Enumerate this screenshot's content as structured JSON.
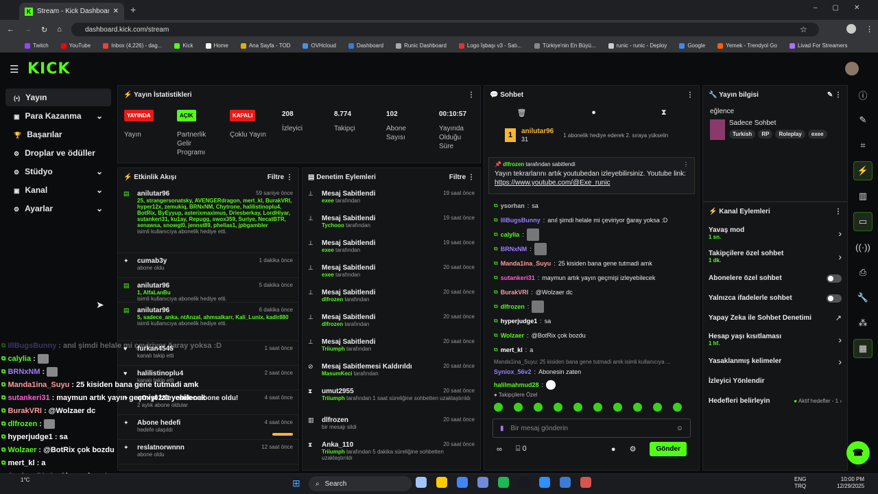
{
  "browser": {
    "tab_title": "Stream - Kick Dashboard",
    "url": "dashboard.kick.com/stream",
    "bookmarks": [
      "Twitch",
      "YouTube",
      "Inbox (4,226) - dag...",
      "Kick",
      "Home",
      "Ana Sayfa - TOD",
      "OVHcloud",
      "Dashboard",
      "Runic Dashboard",
      "Logo İşbaşı v3 - Satı...",
      "Türkiye'nin En Büyü...",
      "runic - runic - Deploy",
      "Google",
      "Yemek - Trendyol Go",
      "Livad For Streamers"
    ]
  },
  "sidebar": {
    "items": [
      {
        "label": "Yayın"
      },
      {
        "label": "Para Kazanma"
      },
      {
        "label": "Başarılar"
      },
      {
        "label": "Droplar ve ödüller"
      },
      {
        "label": "Stüdyo"
      },
      {
        "label": "Kanal"
      },
      {
        "label": "Ayarlar"
      }
    ]
  },
  "stats": {
    "title": "Yayın İstatistikleri",
    "s1_badge": "YAYINDA",
    "s1_label": "Yayın",
    "s2_badge": "AÇIK",
    "s2_label": "Partnerlik Gelir Programı",
    "s3_badge": "KAPALI",
    "s3_label": "Çoklu Yayın",
    "s4_val": "208",
    "s4_label": "İzleyici",
    "s5_val": "8.774",
    "s5_label": "Takipçi",
    "s6_val": "102",
    "s6_label": "Abone Sayısı",
    "s7_val": "00:10:57",
    "s7_label": "Yayında Olduğu Süre"
  },
  "activity": {
    "title": "Etkinlik Akışı",
    "filter": "Filtre",
    "items": [
      {
        "name": "anilutar96",
        "time": "59 saniye önce",
        "green": "25, strangersonatsky, AVENGERdragon, mert_kl, BurakVRI, hyper12x, zemukiq, BRNxNM, Chytrone, halilistinoplu4, BotRix, ByEyyup, asterixmaximus, Driesberkay, LordHiyar, sutankeri31, ku1ay, Repugg, swox359, Suriye, NecatBTR, senawsa, snowgl0, jennst89, phelias1, jpbgambler",
        "sub": "isimli kullanıcıya abonelik hediye etti."
      },
      {
        "name": "cumab3y",
        "time": "1 dakika önce",
        "green": "",
        "sub": "abone oldu"
      },
      {
        "name": "anilutar96",
        "time": "5 dakika önce",
        "green": "1, AlfaLanBu",
        "sub": "isimli kullanıcıya abonelik hediye etti."
      },
      {
        "name": "anilutar96",
        "time": "6 dakika önce",
        "green": "5, sadece_anka, ntAnzal, ahmsalkarr, Kali_Lunix, kadir880",
        "sub": "isimli kullanıcıya abonelik hediye etti."
      },
      {
        "name": "furkan4545",
        "time": "1 saat önce",
        "green": "",
        "sub": "kanalı takip etti"
      },
      {
        "name": "halilistinoplu4",
        "time": "2 saat önce",
        "green": "",
        "sub": "kanalı takip etti"
      },
      {
        "name": "nOxy0231 yeniden abone oldu!",
        "time": "4 saat önce",
        "green": "",
        "sub": "2 aylık abone oldular"
      },
      {
        "name": "Abone hedefi",
        "time": "4 saat önce",
        "green": "",
        "sub": "hedefe ulaşıldı"
      },
      {
        "name": "reslatnorwnnn",
        "time": "12 saat önce",
        "green": "",
        "sub": "abone oldu"
      }
    ]
  },
  "moderation": {
    "title": "Denetim Eylemleri",
    "filter": "Filtre",
    "items": [
      {
        "title": "Mesaj Sabitlendi",
        "time": "19 saat önce",
        "user": "exee",
        "suffix": "tarafından"
      },
      {
        "title": "Mesaj Sabitlendi",
        "time": "19 saat önce",
        "user": "Tychooo",
        "suffix": "tarafından"
      },
      {
        "title": "Mesaj Sabitlendi",
        "time": "19 saat önce",
        "user": "exee",
        "suffix": "tarafından"
      },
      {
        "title": "Mesaj Sabitlendi",
        "time": "20 saat önce",
        "user": "exee",
        "suffix": "tarafından"
      },
      {
        "title": "Mesaj Sabitlendi",
        "time": "20 saat önce",
        "user": "dlfrozen",
        "suffix": "tarafından"
      },
      {
        "title": "Mesaj Sabitlendi",
        "time": "20 saat önce",
        "user": "dlfrozen",
        "suffix": "tarafından"
      },
      {
        "title": "Mesaj Sabitlendi",
        "time": "20 saat önce",
        "user": "Triiumph",
        "suffix": "tarafından"
      },
      {
        "title": "Mesaj Sabitlemesi Kaldırıldı",
        "time": "20 saat önce",
        "user": "MasumKeci",
        "suffix": "tarafından"
      },
      {
        "title": "umut2955",
        "time": "20 saat önce",
        "user": "Triiumph",
        "suffix": "tarafından 1 saat süreliğine sohbetten uzaklaştırıldı"
      },
      {
        "title": "dlfrozen",
        "time": "20 saat önce",
        "user": "",
        "suffix": "bir mesajı sildi"
      },
      {
        "title": "Anka_110",
        "time": "20 saat önce",
        "user": "Triiumph",
        "suffix": "tarafından 5 dakika süreliğine sohbetten uzaklaştırıldı"
      }
    ]
  },
  "chat": {
    "title": "Sohbet",
    "top_user": "anilutar96",
    "top_count": "31",
    "top_note": "1 abonelik hediye ederek 2. sıraya yükselin",
    "pinned_by": "dlfrozen",
    "pinned_suffix": "tarafından sabitlendi",
    "pinned_text": "Yayın tekrarlarını artık youtubedan izleyebilirsiniz. Youtube link:",
    "pinned_link": "https://www.youtube.com/@Exe_runic",
    "lines": [
      {
        "user": "ysorhan",
        "color": "#bbbbbb",
        "text": "sa"
      },
      {
        "user": "IllBugsBunny",
        "color": "#9b7cff",
        "text": "anıl şimdi helale mi çeviriyor ğaray yoksa :D"
      },
      {
        "user": "calylia",
        "color": "#53fc18",
        "text": ""
      },
      {
        "user": "BRNxNM",
        "color": "#9b7cff",
        "text": ""
      },
      {
        "user": "Manda1ina_Suyu",
        "color": "#ff9a9a",
        "text": "25 kisiden bana gene tutmadi amk"
      },
      {
        "user": "sutankeri31",
        "color": "#ff5ecf",
        "text": "maymun artık yayın geçmişi izleyebilecek"
      },
      {
        "user": "BurakVRI",
        "color": "#ff9a9a",
        "text": "@Wolzaer dc"
      },
      {
        "user": "dlfrozen",
        "color": "#53fc18",
        "text": ""
      },
      {
        "user": "hyperjudge1",
        "color": "#ffffff",
        "text": "sa"
      },
      {
        "user": "Wolzaer",
        "color": "#53fc18",
        "text": "@BotRix çok bozdu"
      },
      {
        "user": "mert_kl",
        "color": "#ffffff",
        "text": "a"
      }
    ],
    "reply_text": "Manda1ina_Suyu: 25 kisiden bana gene tutmadi amk isimli kullanıcıya ...",
    "reply_user": "Syniox_56v2",
    "reply_msg": "Abonesin zaten",
    "last_user": "halilmahmud28",
    "followers_only": "Takipçilere Özel",
    "placeholder": "Bir mesaj gönderin",
    "points": "0",
    "send": "Gönder"
  },
  "info": {
    "title": "Yayın bilgisi",
    "category": "eğlence",
    "stream_title": "Sadece Sohbet",
    "tags": [
      "Turkish",
      "RP",
      "Roleplay",
      "exee"
    ]
  },
  "actions": {
    "title": "Kanal Eylemleri",
    "items": [
      {
        "label": "Yavaş mod",
        "sub": "1 sn.",
        "type": "arrow"
      },
      {
        "label": "Takipçilere özel sohbet",
        "sub": "1 dk.",
        "type": "arrow"
      },
      {
        "label": "Abonelere özel sohbet",
        "sub": "",
        "type": "toggle"
      },
      {
        "label": "Yalnızca ifadelerle sohbet",
        "sub": "",
        "type": "toggle"
      },
      {
        "label": "Yapay Zeka ile Sohbet Denetimi",
        "sub": "",
        "type": "ext"
      },
      {
        "label": "Hesap yaşı kısıtlaması",
        "sub": "1 hf.",
        "type": "arrow"
      },
      {
        "label": "Yasaklanmış kelimeler",
        "sub": "",
        "type": "arrow"
      },
      {
        "label": "İzleyici Yönlendir",
        "sub": "",
        "type": "none"
      },
      {
        "label": "Hedefleri belirleyin",
        "sub": "",
        "type": "goal",
        "extra": "Aktif hedefler - 1"
      }
    ]
  },
  "overlay": {
    "lines": [
      {
        "user": "IllBugsBunny",
        "color": "#9b7cff",
        "text": "anıl şimdi helale mi çeviriyor ğaray yoksa :D"
      },
      {
        "user": "calylia",
        "color": "#53fc18",
        "text": ""
      },
      {
        "user": "BRNxNM",
        "color": "#9b7cff",
        "text": ""
      },
      {
        "user": "Manda1ina_Suyu",
        "color": "#ff9a9a",
        "text": "25 kisiden bana gene tutmadi amk"
      },
      {
        "user": "sutankeri31",
        "color": "#ff5ecf",
        "text": "maymun artık yayın geçmişi izleyebilecek"
      },
      {
        "user": "BurakVRI",
        "color": "#ff9a9a",
        "text": "@Wolzaer dc"
      },
      {
        "user": "dlfrozen",
        "color": "#53fc18",
        "text": ""
      },
      {
        "user": "hyperjudge1",
        "color": "#ffffff",
        "text": "sa"
      },
      {
        "user": "Wolzaer",
        "color": "#53fc18",
        "text": "@BotRix çok bozdu"
      },
      {
        "user": "mert_kl",
        "color": "#ffffff",
        "text": "a"
      },
      {
        "user": "Syniox_56v2",
        "color": "#9b7cff",
        "text": "Abonesin zaten"
      },
      {
        "user": "halilmahmud28",
        "color": "#53fc18",
        "text": ""
      }
    ]
  },
  "taskbar": {
    "search": "Search",
    "lang": "ENG",
    "lang2": "TRQ",
    "time": "10:00 PM",
    "date": "12/29/2025",
    "temp": "1°C"
  }
}
